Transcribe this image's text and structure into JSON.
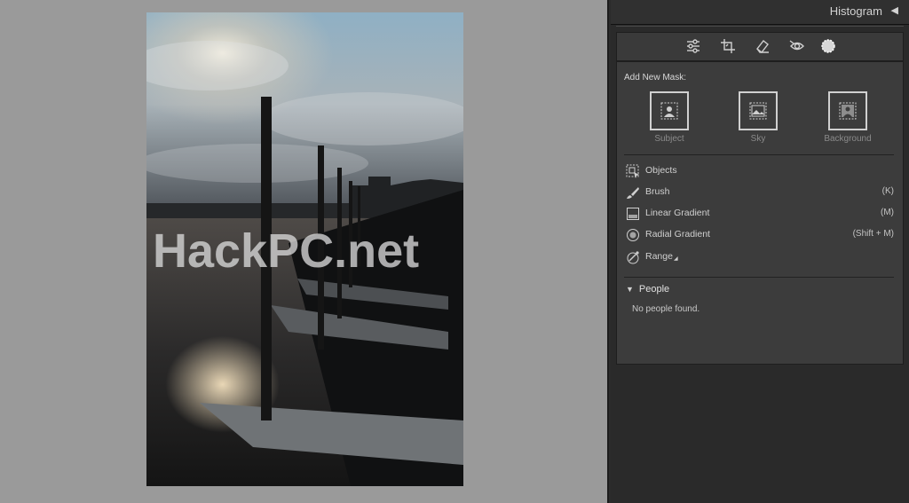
{
  "panel": {
    "histogram_title": "Histogram",
    "histogram_toggle": "◀"
  },
  "toolstrip": {
    "tools": [
      "edit-sliders-icon",
      "crop-icon",
      "healing-eraser-icon",
      "red-eye-icon",
      "masking-icon"
    ],
    "active_tool": "masking-icon"
  },
  "masking": {
    "add_new_mask_label": "Add New Mask:",
    "quick_masks": [
      {
        "label": "Subject",
        "icon": "subject-mask-icon"
      },
      {
        "label": "Sky",
        "icon": "sky-mask-icon"
      },
      {
        "label": "Background",
        "icon": "background-mask-icon"
      }
    ],
    "tools": [
      {
        "label": "Objects",
        "shortcut": "",
        "icon": "objects-icon"
      },
      {
        "label": "Brush",
        "shortcut": "(K)",
        "icon": "brush-icon"
      },
      {
        "label": "Linear Gradient",
        "shortcut": "(M)",
        "icon": "linear-gradient-icon"
      },
      {
        "label": "Radial Gradient",
        "shortcut": "(Shift + M)",
        "icon": "radial-gradient-icon"
      },
      {
        "label": "Range",
        "shortcut": "",
        "icon": "range-icon"
      }
    ],
    "range_submenu_indicator": "◢"
  },
  "people": {
    "title": "People",
    "expand_indicator": "▼",
    "empty_text": "No people found."
  },
  "canvas": {
    "watermark": "HackPC.net"
  },
  "colors": {
    "canvas_bg": "#9a9a9a",
    "panel_bg": "#2a2a2a",
    "mask_panel_bg": "#3c3c3c",
    "text": "#d0d0d0",
    "muted_text": "#8a8a8a"
  }
}
